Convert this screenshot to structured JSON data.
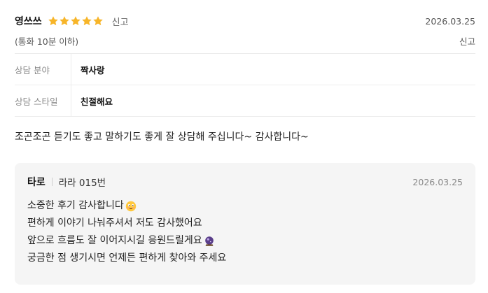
{
  "review": {
    "username": "영쓰쓰",
    "rating": 5,
    "report_label": "신고",
    "date": "2026.03.25",
    "duration": "(통화 10분 이하)",
    "report_label_right": "신고",
    "info": [
      {
        "label": "상담 분야",
        "value": "짝사랑"
      },
      {
        "label": "상담 스타일",
        "value": "친절해요"
      }
    ],
    "text": "조곤조곤 듣기도 좋고 말하기도 좋게 잘 상담해 주십니다~ 감사합니다~"
  },
  "reply": {
    "name": "타로",
    "counselor": "라라 015번",
    "date": "2026.03.25",
    "lines": [
      "소중한 후기 감사합니다",
      "편하게 이야기 나눠주셔서 저도 감사했어요",
      "앞으로 흐름도 잘 이어지시길 응원드릴게요",
      "궁금한 점 생기시면 언제든 편하게 찾아와 주세요"
    ],
    "emoji_icons": [
      "smiling-face-icon",
      "crystal-ball-icon"
    ]
  },
  "colors": {
    "star": "#f7b529",
    "reply_bg": "#f5f5f5",
    "divider": "#ececec"
  }
}
